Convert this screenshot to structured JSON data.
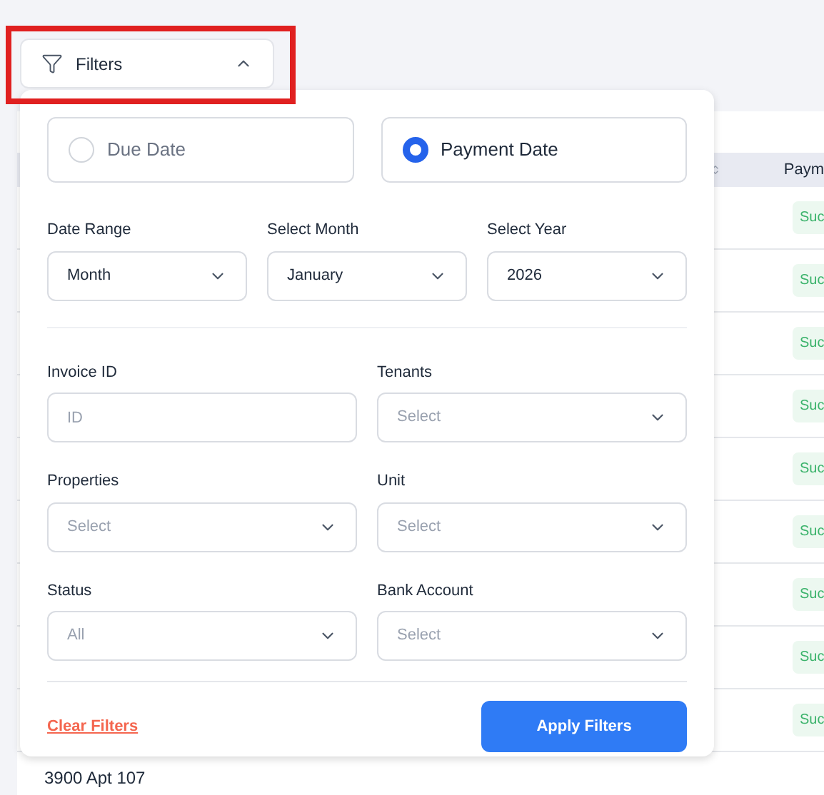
{
  "filters_button": {
    "label": "Filters",
    "expanded": true
  },
  "date_type": [
    {
      "label": "Due Date",
      "selected": false
    },
    {
      "label": "Payment Date",
      "selected": true
    }
  ],
  "date_fields": [
    {
      "label": "Date Range",
      "value": "Month"
    },
    {
      "label": "Select Month",
      "value": "January"
    },
    {
      "label": "Select Year",
      "value": "2026"
    }
  ],
  "fields": [
    {
      "label": "Invoice ID",
      "kind": "input",
      "placeholder": "ID"
    },
    {
      "label": "Tenants",
      "kind": "select",
      "placeholder": "Select"
    },
    {
      "label": "Properties",
      "kind": "select",
      "placeholder": "Select"
    },
    {
      "label": "Unit",
      "kind": "select",
      "placeholder": "Select"
    },
    {
      "label": "Status",
      "kind": "select",
      "placeholder": "All"
    },
    {
      "label": "Bank Account",
      "kind": "select",
      "placeholder": "Select"
    }
  ],
  "clear_link": "Clear Filters",
  "apply_button": "Apply Filters",
  "table": {
    "column_header": "Paym",
    "status_badges": [
      "Suc",
      "Suc",
      "Suc",
      "Suc",
      "Suc",
      "Suc",
      "Suc",
      "Suc",
      "Suc"
    ],
    "last_row_text": "3900 Apt 107"
  }
}
